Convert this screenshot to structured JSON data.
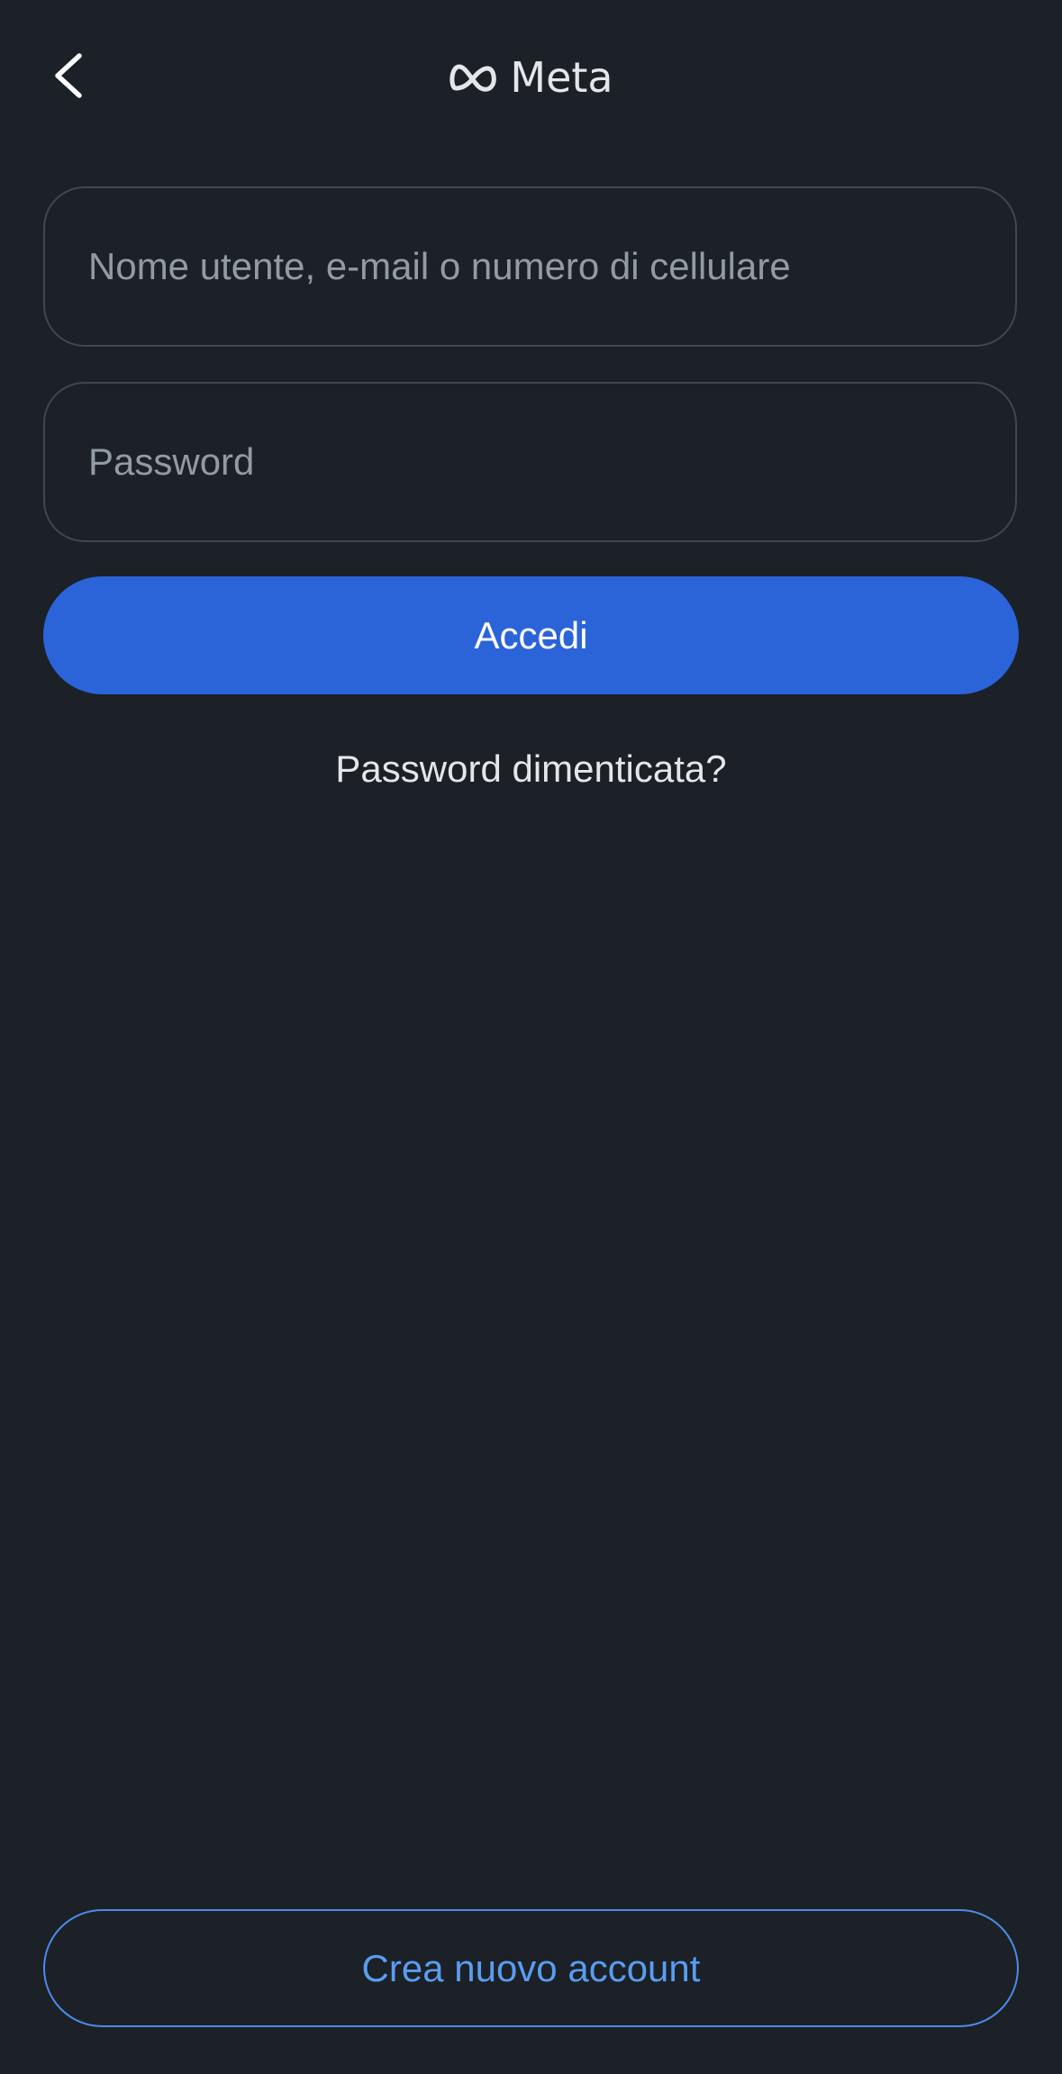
{
  "header": {
    "back_icon": "chevron-left-icon",
    "logo_icon": "meta-infinity-icon",
    "logo_text": "Meta"
  },
  "form": {
    "username": {
      "placeholder": "Nome utente, e-mail o numero di cellulare",
      "value": ""
    },
    "password": {
      "placeholder": "Password",
      "value": ""
    },
    "login_label": "Accedi",
    "forgot_label": "Password dimenticata?"
  },
  "footer": {
    "create_account_label": "Crea nuovo account"
  },
  "colors": {
    "background": "#1b2127",
    "primary": "#2b63d9",
    "link_outline": "#4d8ae8",
    "text": "#e4e6eb",
    "placeholder": "#929ba4"
  }
}
